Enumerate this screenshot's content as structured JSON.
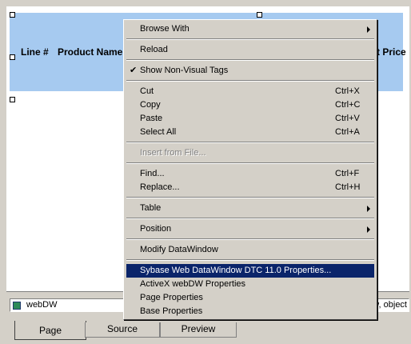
{
  "header": {
    "col_line": "Line #",
    "col_product": "Product Name",
    "col_price_partial": "t Price"
  },
  "object_field": {
    "name": "webDW",
    "right_text": "w, object"
  },
  "tabs": [
    {
      "label": "Page",
      "active": true
    },
    {
      "label": "Source",
      "active": false
    },
    {
      "label": "Preview",
      "active": false
    }
  ],
  "context_menu": {
    "items": {
      "browse_with": "Browse With",
      "reload": "Reload",
      "show_non_visual": "Show Non-Visual Tags",
      "cut": "Cut",
      "cut_acc": "Ctrl+X",
      "copy": "Copy",
      "copy_acc": "Ctrl+C",
      "paste": "Paste",
      "paste_acc": "Ctrl+V",
      "select_all": "Select All",
      "select_all_acc": "Ctrl+A",
      "insert_from_file": "Insert from File...",
      "find": "Find...",
      "find_acc": "Ctrl+F",
      "replace": "Replace...",
      "replace_acc": "Ctrl+H",
      "table": "Table",
      "position": "Position",
      "modify_datawindow": "Modify DataWindow",
      "sybase_props": "Sybase Web DataWindow DTC 11.0 Properties...",
      "activex_props": "ActiveX webDW Properties",
      "page_props": "Page Properties",
      "base_props": "Base Properties"
    },
    "check_mark": "✔"
  },
  "colors": {
    "header_band": "#a6caf0",
    "highlight": "#0a246a",
    "face": "#d4d0c8"
  }
}
